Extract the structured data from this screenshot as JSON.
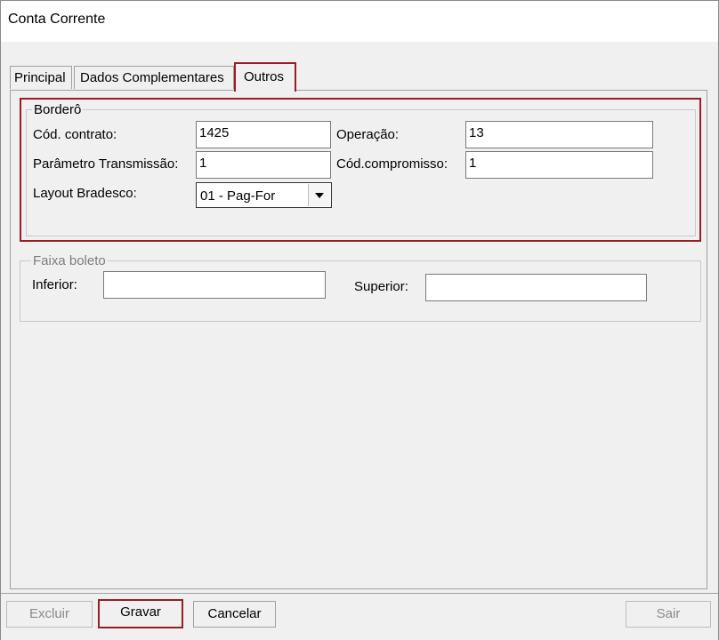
{
  "window": {
    "title": "Conta Corrente"
  },
  "tabs": [
    {
      "label": "Principal"
    },
    {
      "label": "Dados Complementares"
    },
    {
      "label": "Outros",
      "active": true
    }
  ],
  "bordero": {
    "legend": "Borderô",
    "cod_contrato": {
      "label": "Cód. contrato:",
      "value": "1425"
    },
    "operacao": {
      "label": "Operação:",
      "value": "13"
    },
    "parametro_transmissao": {
      "label": "Parâmetro Transmissão:",
      "value": "1"
    },
    "cod_compromisso": {
      "label": "Cód.compromisso:",
      "value": "1"
    },
    "layout_bradesco": {
      "label": "Layout Bradesco:",
      "selected": "01 - Pag-For"
    }
  },
  "faixa_boleto": {
    "legend": "Faixa boleto",
    "inferior": {
      "label": "Inferior:",
      "value": ""
    },
    "superior": {
      "label": "Superior:",
      "value": ""
    }
  },
  "buttons": {
    "excluir": "Excluir",
    "gravar": "Gravar",
    "cancelar": "Cancelar",
    "sair": "Sair"
  },
  "colors": {
    "highlight": "#9b1c24",
    "background": "#f0f0f0"
  }
}
